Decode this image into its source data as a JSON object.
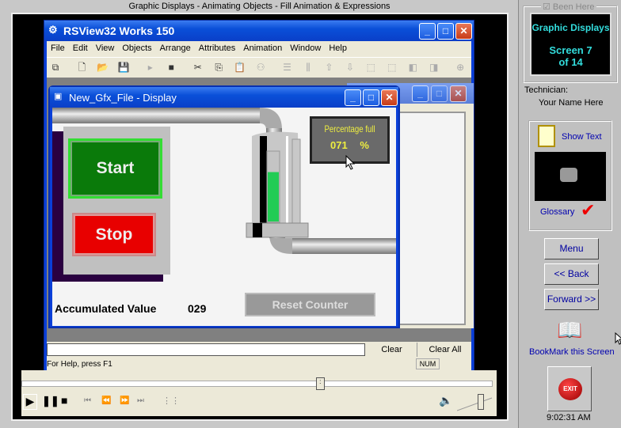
{
  "frame": {
    "title": "Graphic Displays - Animating Objects - Fill Animation & Expressions"
  },
  "app": {
    "title": "RSView32 Works 150",
    "menu": [
      "File",
      "Edit",
      "View",
      "Objects",
      "Arrange",
      "Attributes",
      "Animation",
      "Window",
      "Help"
    ],
    "toolbar_icons": [
      "cascade-windows",
      "new",
      "open",
      "save",
      "run",
      "stop",
      "cut",
      "copy",
      "paste",
      "group",
      "align-horizontal",
      "align-vertical",
      "bring-forward",
      "send-backward",
      "resize-1",
      "resize-2",
      "layer-front",
      "layer-back",
      "zoom-in",
      "zoom-out",
      "swap"
    ],
    "clear_label": "Clear",
    "clear_all_label": "Clear All",
    "status_text": "For Help, press F1",
    "num_indicator": "NUM"
  },
  "display": {
    "title": "New_Gfx_File - Display",
    "start_label": "Start",
    "stop_label": "Stop",
    "percentage_label": "Percentage full",
    "percentage_value": "071",
    "percentage_unit": "%",
    "tank_fill_fraction": 0.71,
    "accumulated_label": "Accumulated Value",
    "accumulated_value": "029",
    "reset_label": "Reset Counter"
  },
  "player": {
    "progress_fraction": 0.63,
    "volume_fraction": 0.6
  },
  "right_panel": {
    "been_here_label": "Been Here",
    "been_here_checked": true,
    "topic": "Graphic Displays",
    "screen_line1": "Screen 7",
    "screen_line2": "of 14",
    "technician_label": "Technician:",
    "technician_name": "Your Name Here",
    "show_text_label": "Show Text",
    "glossary_label": "Glossary",
    "menu_label": "Menu",
    "back_label": "<< Back",
    "forward_label": "Forward >>",
    "bookmark_label": "BookMark this Screen",
    "exit_label": "EXIT",
    "time": "9:02:31 AM"
  }
}
